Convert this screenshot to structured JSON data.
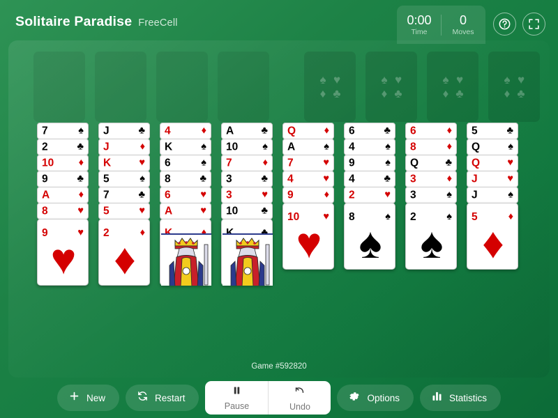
{
  "header": {
    "app_title": "Solitaire Paradise",
    "game_variant": "FreeCell",
    "time_value": "0:00",
    "time_label": "Time",
    "moves_value": "0",
    "moves_label": "Moves",
    "help_icon": "question-circle-icon",
    "fullscreen_icon": "fullscreen-expand-icon"
  },
  "board": {
    "free_cells": [
      {
        "name": "free-cell-1",
        "empty": true
      },
      {
        "name": "free-cell-2",
        "empty": true
      },
      {
        "name": "free-cell-3",
        "empty": true
      },
      {
        "name": "free-cell-4",
        "empty": true
      }
    ],
    "foundations": [
      {
        "name": "foundation-1",
        "suits": [
          "♠",
          "♥",
          "♦",
          "♣"
        ]
      },
      {
        "name": "foundation-2",
        "suits": [
          "♠",
          "♥",
          "♦",
          "♣"
        ]
      },
      {
        "name": "foundation-3",
        "suits": [
          "♠",
          "♥",
          "♦",
          "♣"
        ]
      },
      {
        "name": "foundation-4",
        "suits": [
          "♠",
          "♥",
          "♦",
          "♣"
        ]
      }
    ],
    "tableau": [
      {
        "cards": [
          {
            "rank": "7",
            "suit": "♠",
            "color": "black"
          },
          {
            "rank": "2",
            "suit": "♣",
            "color": "black"
          },
          {
            "rank": "10",
            "suit": "♦",
            "color": "red"
          },
          {
            "rank": "9",
            "suit": "♣",
            "color": "black"
          },
          {
            "rank": "A",
            "suit": "♦",
            "color": "red"
          },
          {
            "rank": "8",
            "suit": "♥",
            "color": "red"
          },
          {
            "rank": "9",
            "suit": "♥",
            "color": "red"
          }
        ]
      },
      {
        "cards": [
          {
            "rank": "J",
            "suit": "♣",
            "color": "black"
          },
          {
            "rank": "J",
            "suit": "♦",
            "color": "red"
          },
          {
            "rank": "K",
            "suit": "♥",
            "color": "red"
          },
          {
            "rank": "5",
            "suit": "♠",
            "color": "black"
          },
          {
            "rank": "7",
            "suit": "♣",
            "color": "black"
          },
          {
            "rank": "5",
            "suit": "♥",
            "color": "red"
          },
          {
            "rank": "2",
            "suit": "♦",
            "color": "red"
          }
        ]
      },
      {
        "cards": [
          {
            "rank": "4",
            "suit": "♦",
            "color": "red"
          },
          {
            "rank": "K",
            "suit": "♠",
            "color": "black"
          },
          {
            "rank": "6",
            "suit": "♠",
            "color": "black"
          },
          {
            "rank": "8",
            "suit": "♣",
            "color": "black"
          },
          {
            "rank": "6",
            "suit": "♥",
            "color": "red"
          },
          {
            "rank": "A",
            "suit": "♥",
            "color": "red"
          },
          {
            "rank": "K",
            "suit": "♦",
            "color": "red",
            "face": true
          }
        ]
      },
      {
        "cards": [
          {
            "rank": "A",
            "suit": "♣",
            "color": "black"
          },
          {
            "rank": "10",
            "suit": "♠",
            "color": "black"
          },
          {
            "rank": "7",
            "suit": "♦",
            "color": "red"
          },
          {
            "rank": "3",
            "suit": "♣",
            "color": "black"
          },
          {
            "rank": "3",
            "suit": "♥",
            "color": "red"
          },
          {
            "rank": "10",
            "suit": "♣",
            "color": "black"
          },
          {
            "rank": "K",
            "suit": "♣",
            "color": "black",
            "face": true
          }
        ]
      },
      {
        "cards": [
          {
            "rank": "Q",
            "suit": "♦",
            "color": "red"
          },
          {
            "rank": "A",
            "suit": "♠",
            "color": "black"
          },
          {
            "rank": "7",
            "suit": "♥",
            "color": "red"
          },
          {
            "rank": "4",
            "suit": "♥",
            "color": "red"
          },
          {
            "rank": "9",
            "suit": "♦",
            "color": "red"
          },
          {
            "rank": "10",
            "suit": "♥",
            "color": "red"
          }
        ]
      },
      {
        "cards": [
          {
            "rank": "6",
            "suit": "♣",
            "color": "black"
          },
          {
            "rank": "4",
            "suit": "♠",
            "color": "black"
          },
          {
            "rank": "9",
            "suit": "♠",
            "color": "black"
          },
          {
            "rank": "4",
            "suit": "♣",
            "color": "black"
          },
          {
            "rank": "2",
            "suit": "♥",
            "color": "red"
          },
          {
            "rank": "8",
            "suit": "♠",
            "color": "black"
          }
        ]
      },
      {
        "cards": [
          {
            "rank": "6",
            "suit": "♦",
            "color": "red"
          },
          {
            "rank": "8",
            "suit": "♦",
            "color": "red"
          },
          {
            "rank": "Q",
            "suit": "♣",
            "color": "black"
          },
          {
            "rank": "3",
            "suit": "♦",
            "color": "red"
          },
          {
            "rank": "3",
            "suit": "♠",
            "color": "black"
          },
          {
            "rank": "2",
            "suit": "♠",
            "color": "black"
          }
        ]
      },
      {
        "cards": [
          {
            "rank": "5",
            "suit": "♣",
            "color": "black"
          },
          {
            "rank": "Q",
            "suit": "♠",
            "color": "black"
          },
          {
            "rank": "Q",
            "suit": "♥",
            "color": "red"
          },
          {
            "rank": "J",
            "suit": "♥",
            "color": "red"
          },
          {
            "rank": "J",
            "suit": "♠",
            "color": "black"
          },
          {
            "rank": "5",
            "suit": "♦",
            "color": "red"
          }
        ]
      }
    ]
  },
  "footer": {
    "game_id": "Game #592820",
    "buttons": [
      {
        "label": "New",
        "icon": "plus-icon",
        "style": "pill"
      },
      {
        "label": "Restart",
        "icon": "refresh-icon",
        "style": "pill"
      },
      {
        "label": "Pause",
        "icon": "pause-icon",
        "style": "white"
      },
      {
        "label": "Undo",
        "icon": "undo-icon",
        "style": "white"
      },
      {
        "label": "Options",
        "icon": "gear-icon",
        "style": "pill"
      },
      {
        "label": "Statistics",
        "icon": "bar-chart-icon",
        "style": "pill"
      }
    ]
  },
  "colors": {
    "felt_green": "#38855a",
    "header_green": "#17803f",
    "card_white": "#ffffff",
    "red_suit": "#d40000",
    "black_suit": "#000000"
  }
}
